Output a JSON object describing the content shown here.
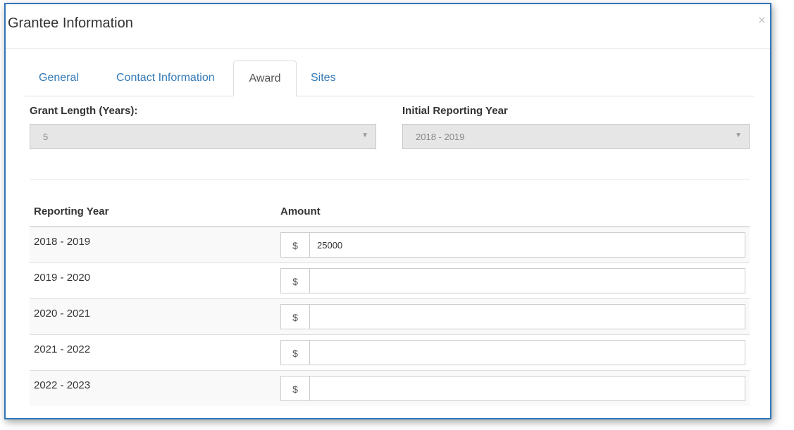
{
  "modal": {
    "title": "Grantee Information",
    "close_glyph": "×"
  },
  "tabs": [
    {
      "label": "General",
      "active": false
    },
    {
      "label": "Contact Information",
      "active": false
    },
    {
      "label": "Award",
      "active": true
    },
    {
      "label": "Sites",
      "active": false
    }
  ],
  "form": {
    "grant_length": {
      "label": "Grant Length (Years):",
      "value": "5",
      "disabled": true
    },
    "initial_year": {
      "label": "Initial Reporting Year",
      "value": "2018 - 2019",
      "disabled": true
    }
  },
  "table": {
    "headers": [
      "Reporting Year",
      "Amount"
    ],
    "currency_symbol": "$",
    "rows": [
      {
        "year": "2018 - 2019",
        "amount": "25000"
      },
      {
        "year": "2019 - 2020",
        "amount": ""
      },
      {
        "year": "2020 - 2021",
        "amount": ""
      },
      {
        "year": "2021 - 2022",
        "amount": ""
      },
      {
        "year": "2022 - 2023",
        "amount": ""
      }
    ]
  },
  "colors": {
    "accent": "#2f76b8",
    "link": "#337ab7",
    "disabled_bg": "#e6e6e6"
  },
  "icons": {
    "dropdown": "caret-down-icon",
    "close": "close-icon"
  }
}
